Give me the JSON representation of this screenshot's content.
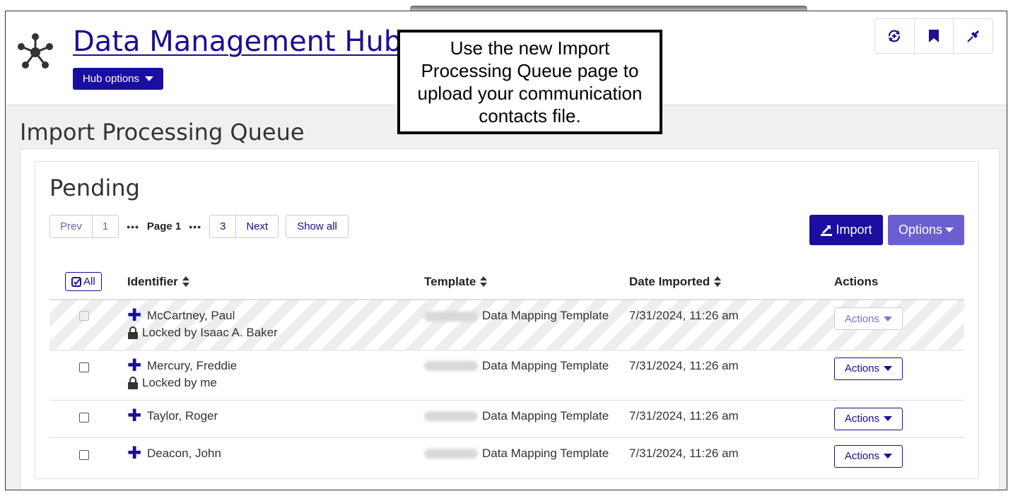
{
  "header": {
    "title": "Data Management Hub",
    "hub_options_label": "Hub options",
    "icons": [
      "sync-icon",
      "bookmark-icon",
      "pin-icon"
    ]
  },
  "callout": {
    "text": "Use the new Import Processing Queue page to upload your communication contacts file."
  },
  "page": {
    "heading": "Import Processing Queue"
  },
  "pending": {
    "title": "Pending",
    "pager": {
      "prev": "Prev",
      "first": "1",
      "dots": "•••",
      "current": "Page 1",
      "last": "3",
      "next": "Next",
      "show_all": "Show all"
    },
    "import_label": "Import",
    "options_label": "Options",
    "table": {
      "select_all_label": "All",
      "columns": [
        "Identifier",
        "Template",
        "Date Imported",
        "Actions"
      ],
      "rows": [
        {
          "identifier": "McCartney, Paul",
          "lock": "Locked by Isaac A. Baker",
          "template": "Data Mapping Template",
          "date": "7/31/2024, 11:26 am",
          "actions": "Actions",
          "locked": true
        },
        {
          "identifier": "Mercury, Freddie",
          "lock": "Locked by me",
          "template": "Data Mapping Template",
          "date": "7/31/2024, 11:26 am",
          "actions": "Actions",
          "locked": false
        },
        {
          "identifier": "Taylor, Roger",
          "lock": "",
          "template": "Data Mapping Template",
          "date": "7/31/2024, 11:26 am",
          "actions": "Actions",
          "locked": false
        },
        {
          "identifier": "Deacon, John",
          "lock": "",
          "template": "Data Mapping Template",
          "date": "7/31/2024, 11:26 am",
          "actions": "Actions",
          "locked": false
        }
      ]
    }
  },
  "colors": {
    "brand": "#1a0ea0",
    "options": "#6b5fd0"
  }
}
